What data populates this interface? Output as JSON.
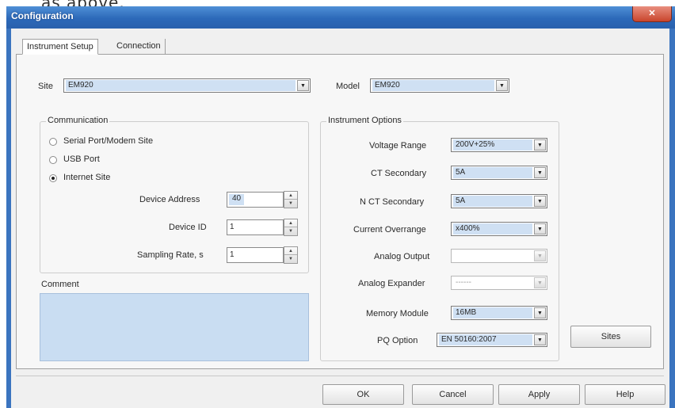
{
  "overlay_text": "as above.",
  "window": {
    "title": "Configuration",
    "close_glyph": "✕"
  },
  "tabs": [
    {
      "label": "Instrument Setup"
    },
    {
      "label": "Connection"
    }
  ],
  "site": {
    "label": "Site",
    "value": "EM920"
  },
  "model": {
    "label": "Model",
    "value": "EM920"
  },
  "communication": {
    "title": "Communication",
    "radios": [
      {
        "label": "Serial Port/Modem Site",
        "checked": false
      },
      {
        "label": "USB Port",
        "checked": false
      },
      {
        "label": "Internet Site",
        "checked": true
      }
    ],
    "device_address": {
      "label": "Device Address",
      "value": "40"
    },
    "device_id": {
      "label": "Device ID",
      "value": "1"
    },
    "sampling_rate": {
      "label": "Sampling Rate, s",
      "value": "1"
    }
  },
  "comment": {
    "label": "Comment",
    "value": ""
  },
  "instrument_options": {
    "title": "Instrument Options",
    "voltage_range": {
      "label": "Voltage Range",
      "value": "200V+25%"
    },
    "ct_secondary": {
      "label": "CT Secondary",
      "value": "5A"
    },
    "n_ct_secondary": {
      "label": "N CT Secondary",
      "value": "5A"
    },
    "current_overrange": {
      "label": "Current Overrange",
      "value": "x400%"
    },
    "analog_output": {
      "label": "Analog Output",
      "value": ""
    },
    "analog_expander": {
      "label": "Analog Expander",
      "value": "------"
    },
    "memory_module": {
      "label": "Memory Module",
      "value": "16MB"
    },
    "pq_option": {
      "label": "PQ Option",
      "value": "EN 50160:2007"
    }
  },
  "buttons": {
    "sites": "Sites",
    "ok": "OK",
    "cancel": "Cancel",
    "apply": "Apply",
    "help": "Help"
  },
  "icons": {
    "dropdown_arrow": "▼",
    "spin_up": "▲",
    "spin_down": "▼"
  }
}
